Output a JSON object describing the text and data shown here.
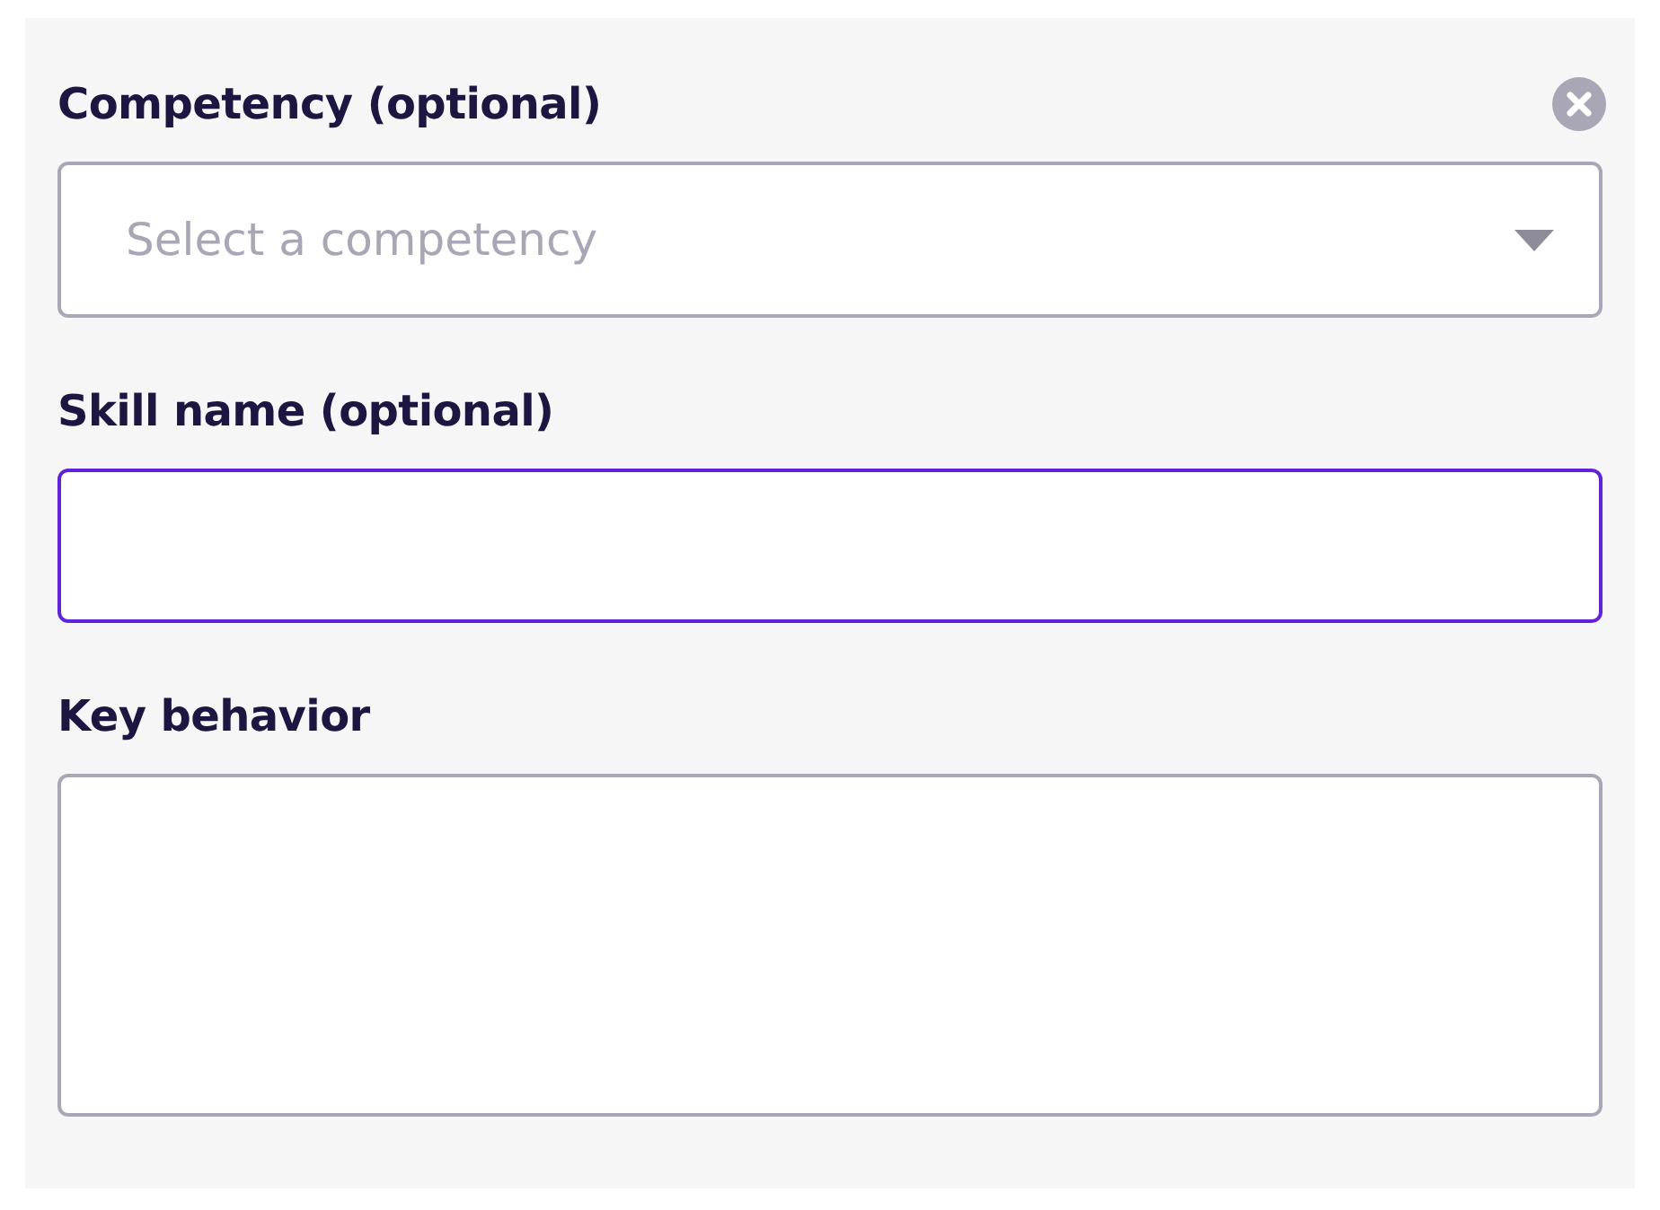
{
  "fields": [
    {
      "kind": "select",
      "label": "Competency (optional)",
      "placeholder": "Select a competency",
      "removable": true,
      "focused": false
    },
    {
      "kind": "input",
      "label": "Skill name (optional)",
      "focused": true
    },
    {
      "kind": "textarea",
      "label": "Key behavior",
      "focused": false
    }
  ]
}
